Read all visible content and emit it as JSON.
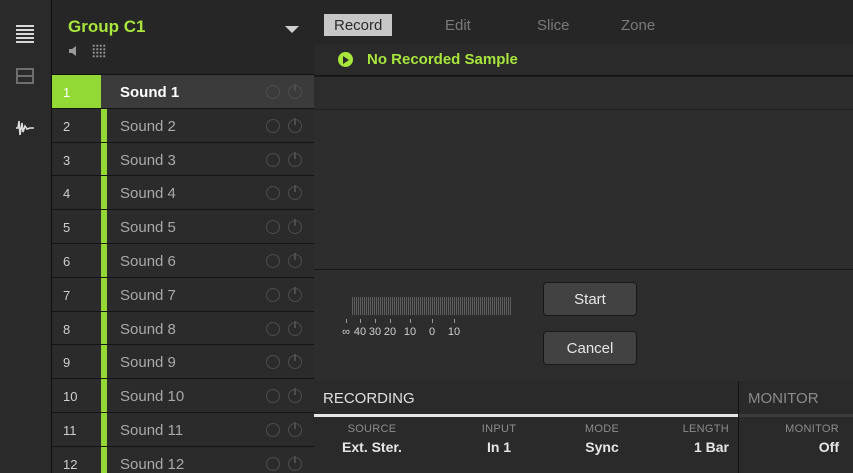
{
  "group": {
    "name": "Group C1"
  },
  "tabs": [
    {
      "label": "Record",
      "active": true
    },
    {
      "label": "Edit",
      "active": false
    },
    {
      "label": "Slice",
      "active": false
    },
    {
      "label": "Zone",
      "active": false
    }
  ],
  "status": {
    "text": "No Recorded Sample"
  },
  "sounds": [
    {
      "num": "1",
      "name": "Sound 1",
      "selected": true
    },
    {
      "num": "2",
      "name": "Sound 2"
    },
    {
      "num": "3",
      "name": "Sound 3"
    },
    {
      "num": "4",
      "name": "Sound 4"
    },
    {
      "num": "5",
      "name": "Sound 5"
    },
    {
      "num": "6",
      "name": "Sound 6"
    },
    {
      "num": "7",
      "name": "Sound 7"
    },
    {
      "num": "8",
      "name": "Sound 8"
    },
    {
      "num": "9",
      "name": "Sound 9"
    },
    {
      "num": "10",
      "name": "Sound 10"
    },
    {
      "num": "11",
      "name": "Sound 11"
    },
    {
      "num": "12",
      "name": "Sound 12"
    }
  ],
  "meter": {
    "scale": [
      "∞",
      "40",
      "30",
      "20",
      "10",
      "0",
      "10"
    ]
  },
  "buttons": {
    "start": "Start",
    "cancel": "Cancel"
  },
  "recording": {
    "title": "RECORDING",
    "params": [
      {
        "label": "SOURCE",
        "value": "Ext. Ster."
      },
      {
        "label": "INPUT",
        "value": "In 1"
      },
      {
        "label": "MODE",
        "value": "Sync"
      },
      {
        "label": "LENGTH",
        "value": "1 Bar"
      }
    ]
  },
  "monitor": {
    "title": "MONITOR",
    "label": "MONITOR",
    "value": "Off"
  },
  "colors": {
    "accent": "#92d936",
    "status": "#a8e63c"
  },
  "icons": [
    "menu-icon",
    "mixer-icon",
    "waveform-icon",
    "speaker-icon",
    "grid-icon",
    "dropdown-arrow-icon",
    "play-icon"
  ]
}
